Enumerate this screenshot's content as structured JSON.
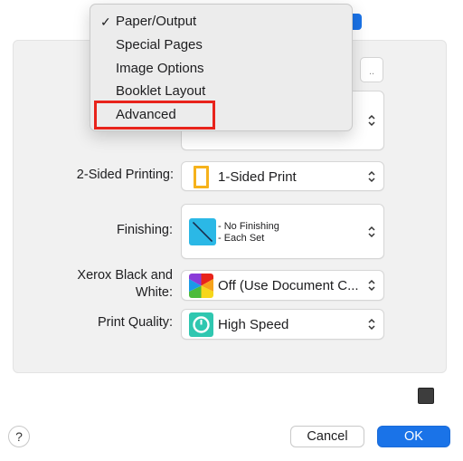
{
  "menu": {
    "items": [
      {
        "label": "Paper/Output",
        "checked": true
      },
      {
        "label": "Special Pages",
        "checked": false
      },
      {
        "label": "Image Options",
        "checked": false
      },
      {
        "label": "Booklet Layout",
        "checked": false
      },
      {
        "label": "Advanced",
        "checked": false
      }
    ],
    "check_mark": "✓"
  },
  "mini_button_label": "..",
  "rows": {
    "two_sided": {
      "label": "2-Sided Printing:",
      "value": "1-Sided Print",
      "icon": "page-icon"
    },
    "finishing": {
      "label": "Finishing:",
      "line1": "- No Finishing",
      "line2": "- Each Set",
      "icon": "staple-icon"
    },
    "color": {
      "label_line1": "Xerox Black and",
      "label_line2": "White:",
      "value": "Off (Use Document C...",
      "icon": "color-wheel-icon"
    },
    "quality": {
      "label": "Print Quality:",
      "value": "High Speed",
      "icon": "speed-gauge-icon"
    }
  },
  "footer": {
    "help": "?",
    "cancel": "Cancel",
    "ok": "OK"
  },
  "colors": {
    "accent": "#1a73e8",
    "highlight": "#e8231b"
  }
}
